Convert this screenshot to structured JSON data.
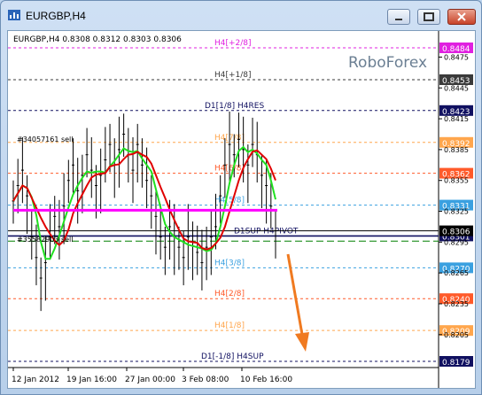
{
  "window": {
    "title": "EURGBP,H4",
    "buttons": {
      "minimize": "minimize",
      "maximize": "maximize",
      "close": "close"
    }
  },
  "chart_header": "EURGBP,H4  0.8308 0.8312 0.8303 0.8306",
  "watermark": "RoboForex",
  "order_labels": {
    "sell_top": "#34057161 sell",
    "sell_low": "#35582903 sell"
  },
  "levels": [
    {
      "label": "H4[+2/8]",
      "price": "0.8484",
      "color": "#e020e0"
    },
    {
      "label": "H4[+1/8]",
      "price": "0.8453",
      "color": "#3a3a3a"
    },
    {
      "label": "D1[1/8] H4RES",
      "price": "0.8423",
      "color": "#101060"
    },
    {
      "label": "H4[7/8]",
      "price": "0.8392",
      "color": "#ffa64d"
    },
    {
      "label": "H4[6/8]",
      "price": "0.8362",
      "color": "#ff5a2a"
    },
    {
      "label": "H4[5/8]",
      "price": "0.8331",
      "color": "#3aa0e0"
    },
    {
      "label": "D1SUP H4PIVOT",
      "price": "0.8301",
      "color": "#101060"
    },
    {
      "label": "H4[3/8]",
      "price": "0.8270",
      "color": "#3aa0e0"
    },
    {
      "label": "H4[2/8]",
      "price": "0.8240",
      "color": "#ff5a2a"
    },
    {
      "label": "H4[1/8]",
      "price": "0.8209",
      "color": "#ffa64d"
    },
    {
      "label": "D1[-1/8] H4SUP",
      "price": "0.8179",
      "color": "#101060"
    }
  ],
  "current_price": {
    "value": "0.8306",
    "color": "#000000"
  },
  "axis_ticks": [
    "0.8475",
    "0.8445",
    "0.8415",
    "0.8385",
    "0.8355",
    "0.8325",
    "0.8295",
    "0.8265",
    "0.8235",
    "0.8205"
  ],
  "time_labels": [
    "12 Jan 2012",
    "19 Jan 16:00",
    "27 Jan 00:00",
    "3 Feb 08:00",
    "10 Feb 16:00"
  ],
  "colors": {
    "accent_arrow": "#f07a20",
    "fast_ma": "#20e020",
    "slow_ma": "#e00000",
    "pivot_bar": "#ff00ff"
  }
}
